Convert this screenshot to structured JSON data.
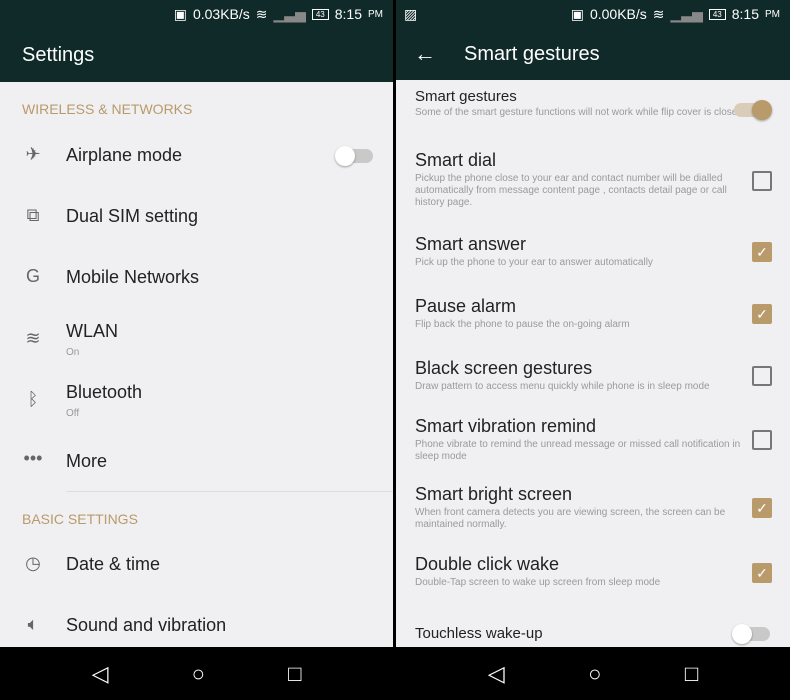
{
  "colors": {
    "header": "#0f2a28",
    "accent": "#b99a6b",
    "background": "#f0f0f2"
  },
  "left": {
    "status": {
      "speed": "0.03KB/s",
      "battery": "43",
      "time": "8:15",
      "ampm": "PM"
    },
    "title": "Settings",
    "sections": [
      {
        "label": "WIRELESS & NETWORKS",
        "items": [
          {
            "icon": "airplane-icon",
            "label": "Airplane mode",
            "toggle": false
          },
          {
            "icon": "dual-sim-icon",
            "label": "Dual SIM setting"
          },
          {
            "icon": "mobile-networks-icon",
            "label": "Mobile Networks"
          },
          {
            "icon": "wifi-icon",
            "label": "WLAN",
            "sub": "On"
          },
          {
            "icon": "bluetooth-icon",
            "label": "Bluetooth",
            "sub": "Off"
          },
          {
            "icon": "more-icon",
            "label": "More"
          }
        ]
      },
      {
        "label": "BASIC SETTINGS",
        "items": [
          {
            "icon": "clock-icon",
            "label": "Date & time"
          },
          {
            "icon": "speaker-icon",
            "label": "Sound and vibration"
          }
        ]
      }
    ]
  },
  "right": {
    "status": {
      "speed": "0.00KB/s",
      "battery": "43",
      "time": "8:15",
      "ampm": "PM"
    },
    "title": "Smart gestures",
    "items": [
      {
        "label": "Smart gestures",
        "desc": "Some of the smart gesture functions will not work while flip cover is closed",
        "control": "toggle",
        "checked": true
      },
      {
        "label": "Smart dial",
        "desc": "Pickup the phone close to your ear and contact number will be dialled automatically from message content page , contacts detail page or call history page.",
        "control": "checkbox",
        "checked": false
      },
      {
        "label": "Smart answer",
        "desc": "Pick up the phone to your ear to answer automatically",
        "control": "checkbox",
        "checked": true
      },
      {
        "label": "Pause alarm",
        "desc": "Flip back the phone to pause the on-going alarm",
        "control": "checkbox",
        "checked": true
      },
      {
        "label": "Black screen gestures",
        "desc": "Draw pattern to access menu quickly while phone is in sleep mode",
        "control": "checkbox",
        "checked": false
      },
      {
        "label": "Smart vibration remind",
        "desc": "Phone vibrate to remind the unread message or missed call notification in sleep mode",
        "control": "checkbox",
        "checked": false
      },
      {
        "label": "Smart bright screen",
        "desc": "When front camera detects you are viewing screen, the screen can be maintained normally.",
        "control": "checkbox",
        "checked": true
      },
      {
        "label": "Double click wake",
        "desc": "Double-Tap screen to wake up screen from sleep mode",
        "control": "checkbox",
        "checked": true
      },
      {
        "label": "Touchless wake-up",
        "desc": "",
        "control": "toggle",
        "checked": false
      }
    ]
  }
}
